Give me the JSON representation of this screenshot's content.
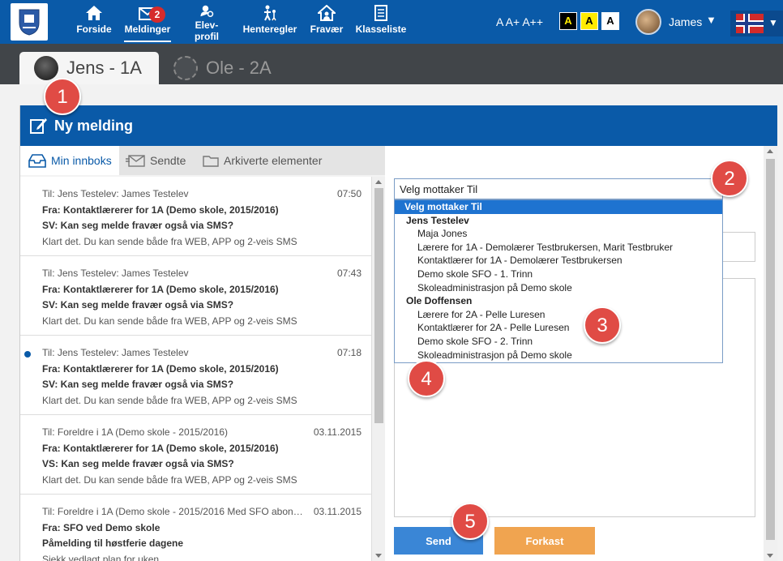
{
  "topnav": {
    "items": [
      {
        "label": "Forside",
        "icon": "home-icon"
      },
      {
        "label": "Meldinger",
        "icon": "mail-icon"
      },
      {
        "label": "Elev-profil",
        "icon": "profile-icon"
      },
      {
        "label": "Henteregler",
        "icon": "pickup-icon"
      },
      {
        "label": "Fravær",
        "icon": "absence-icon"
      },
      {
        "label": "Klasseliste",
        "icon": "classlist-icon"
      }
    ],
    "active": "Meldinger",
    "message_badge": "2",
    "font_size_label": "A A+ A++",
    "contrast_options": [
      "A",
      "A",
      "A"
    ],
    "user_name": "James",
    "user_caret": "▼",
    "flag_caret": "▼"
  },
  "student_tabs": [
    {
      "label": "Jens - 1A",
      "active": true
    },
    {
      "label": "Ole - 2A",
      "active": false
    }
  ],
  "header": {
    "title": "Ny melding",
    "icon": "compose-icon"
  },
  "folders": [
    {
      "label": "Min innboks",
      "icon": "inbox-icon",
      "active": true
    },
    {
      "label": "Sendte",
      "icon": "sent-icon"
    },
    {
      "label": "Arkiverte elementer",
      "icon": "archive-icon"
    }
  ],
  "messages": [
    {
      "to": "Til: Jens Testelev: James Testelev",
      "time": "07:50",
      "from": "Fra: Kontaktlærerer for 1A (Demo skole, 2015/2016)",
      "subject": "SV: Kan seg melde fravær også via SMS?",
      "preview": "Klart det. Du kan sende både fra WEB, APP og 2-veis SMS",
      "unread": false
    },
    {
      "to": "Til: Jens Testelev: James Testelev",
      "time": "07:43",
      "from": "Fra: Kontaktlærerer for 1A (Demo skole, 2015/2016)",
      "subject": "SV: Kan seg melde fravær også via SMS?",
      "preview": "Klart det. Du kan sende både fra WEB, APP og 2-veis SMS",
      "unread": false
    },
    {
      "to": "Til: Jens Testelev: James Testelev",
      "time": "07:18",
      "from": "Fra: Kontaktlærerer for 1A (Demo skole, 2015/2016)",
      "subject": "SV: Kan seg melde fravær også via SMS?",
      "preview": "Klart det. Du kan sende både fra WEB, APP og 2-veis SMS",
      "unread": true
    },
    {
      "to": "Til: Foreldre i 1A (Demo skole - 2015/2016)",
      "time": "03.11.2015",
      "from": "Fra: Kontaktlærerer for 1A (Demo skole, 2015/2016)",
      "subject": "VS: Kan seg melde fravær også via SMS?",
      "preview": "Klart det. Du kan sende både fra WEB, APP og 2-veis SMS",
      "unread": false
    },
    {
      "to": "Til: Foreldre i 1A (Demo skole - 2015/2016 Med SFO abon…",
      "time": "03.11.2015",
      "from": "Fra: SFO ved Demo skole",
      "subject": "Påmelding til høstferie dagene",
      "preview": "Sjekk vedlagt plan for uken.",
      "unread": false
    }
  ],
  "compose": {
    "recipient_select": "Velg mottaker Til",
    "dropdown": [
      {
        "type": "option",
        "label": "Velg mottaker Til",
        "selected": true
      },
      {
        "type": "group",
        "label": "Jens Testelev"
      },
      {
        "type": "option",
        "label": "Maja Jones"
      },
      {
        "type": "option",
        "label": "Lærere for 1A - Demolærer Testbrukersen, Marit Testbruker"
      },
      {
        "type": "option",
        "label": "Kontaktlærer for 1A - Demolærer Testbrukersen"
      },
      {
        "type": "option",
        "label": "Demo skole SFO - 1. Trinn"
      },
      {
        "type": "option",
        "label": "Skoleadministrasjon på Demo skole"
      },
      {
        "type": "group",
        "label": "Ole Doffensen"
      },
      {
        "type": "option",
        "label": "Lærere for 2A - Pelle Luresen"
      },
      {
        "type": "option",
        "label": "Kontaktlærer for 2A - Pelle Luresen"
      },
      {
        "type": "option",
        "label": "Demo skole SFO - 2. Trinn"
      },
      {
        "type": "option",
        "label": "Skoleadministrasjon på Demo skole"
      }
    ],
    "send_label": "Send",
    "discard_label": "Forkast"
  },
  "callouts": [
    "1",
    "2",
    "3",
    "4",
    "5"
  ],
  "colors": {
    "primary": "#0a5aa8",
    "send": "#3a86d6",
    "discard": "#f0a450",
    "callout": "#e04b45"
  }
}
